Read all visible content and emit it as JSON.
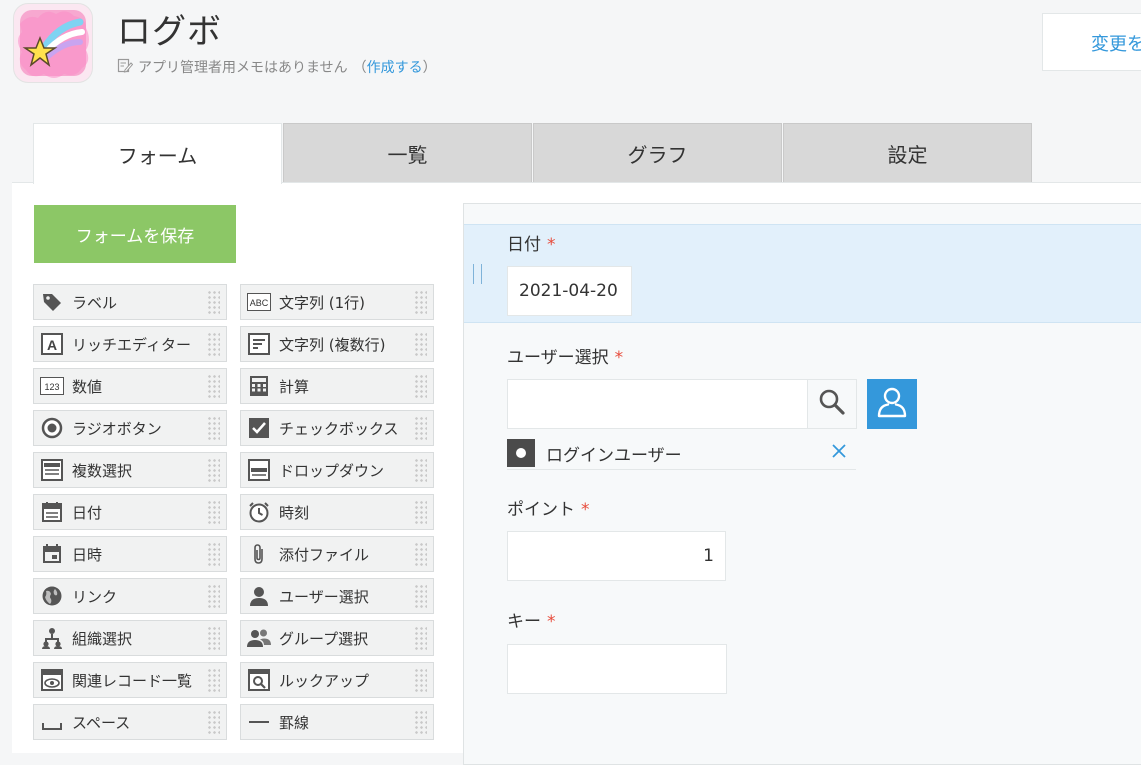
{
  "header": {
    "app_title": "ログボ",
    "memo_text": "アプリ管理者用メモはありません",
    "memo_paren_open": "（",
    "memo_link": "作成する",
    "memo_paren_close": "）",
    "change_button": "変更を"
  },
  "tabs": [
    {
      "label": "フォーム",
      "active": true
    },
    {
      "label": "一覧",
      "active": false
    },
    {
      "label": "グラフ",
      "active": false
    },
    {
      "label": "設定",
      "active": false
    }
  ],
  "sidebar": {
    "save_button": "フォームを保存",
    "parts": [
      {
        "label": "ラベル",
        "icon": "tag-icon"
      },
      {
        "label": "文字列 (1行)",
        "icon": "abc-icon"
      },
      {
        "label": "リッチエディター",
        "icon": "rich-editor-icon"
      },
      {
        "label": "文字列 (複数行)",
        "icon": "multiline-text-icon"
      },
      {
        "label": "数値",
        "icon": "number-icon"
      },
      {
        "label": "計算",
        "icon": "calculator-icon"
      },
      {
        "label": "ラジオボタン",
        "icon": "radio-icon"
      },
      {
        "label": "チェックボックス",
        "icon": "checkbox-icon"
      },
      {
        "label": "複数選択",
        "icon": "multi-select-icon"
      },
      {
        "label": "ドロップダウン",
        "icon": "dropdown-icon"
      },
      {
        "label": "日付",
        "icon": "calendar-icon"
      },
      {
        "label": "時刻",
        "icon": "clock-icon"
      },
      {
        "label": "日時",
        "icon": "datetime-icon"
      },
      {
        "label": "添付ファイル",
        "icon": "paperclip-icon"
      },
      {
        "label": "リンク",
        "icon": "globe-icon"
      },
      {
        "label": "ユーザー選択",
        "icon": "user-icon"
      },
      {
        "label": "組織選択",
        "icon": "org-icon"
      },
      {
        "label": "グループ選択",
        "icon": "group-icon"
      },
      {
        "label": "関連レコード一覧",
        "icon": "related-records-icon"
      },
      {
        "label": "ルックアップ",
        "icon": "lookup-icon"
      },
      {
        "label": "スペース",
        "icon": "space-icon"
      },
      {
        "label": "罫線",
        "icon": "line-icon"
      }
    ]
  },
  "form": {
    "date_label": "日付",
    "date_value": "2021-04-20",
    "user_label": "ユーザー選択",
    "user_search_value": "",
    "user_chip": "ログインユーザー",
    "point_label": "ポイント",
    "point_value": "1",
    "key_label": "キー",
    "key_value": "",
    "required_mark": "*"
  },
  "colors": {
    "accent": "#3498db",
    "save": "#8cc766",
    "required": "#e74c3c",
    "selected_row": "#e2f0fb"
  }
}
